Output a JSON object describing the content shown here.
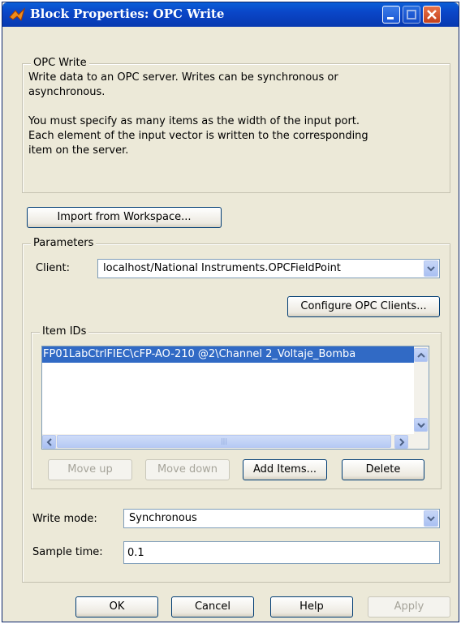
{
  "window": {
    "title": "Block Properties: OPC Write"
  },
  "description": {
    "legend": "OPC Write",
    "line1": "Write data to an OPC server. Writes can be synchronous or",
    "line2": "asynchronous.",
    "line3": "You must specify as many items as the width of the input port.",
    "line4": "Each element of the input vector is written to the corresponding",
    "line5": "item on the server."
  },
  "import_button": "Import from Workspace...",
  "parameters": {
    "legend": "Parameters",
    "client_label": "Client:",
    "client_value": "localhost/National Instruments.OPCFieldPoint",
    "configure_button": "Configure OPC Clients...",
    "item_ids": {
      "legend": "Item IDs",
      "items": [
        "FP01LabCtrlFIEC\\cFP-AO-210 @2\\Channel 2_Voltaje_Bomba"
      ],
      "move_up": "Move up",
      "move_down": "Move down",
      "add_items": "Add Items...",
      "delete": "Delete"
    },
    "write_mode_label": "Write mode:",
    "write_mode_value": "Synchronous",
    "sample_time_label": "Sample time:",
    "sample_time_value": "0.1"
  },
  "buttons": {
    "ok": "OK",
    "cancel": "Cancel",
    "help": "Help",
    "apply": "Apply"
  },
  "colors": {
    "titlebar": "#0a46c8",
    "dialog_bg": "#ece9d8",
    "selection": "#316ac5"
  }
}
